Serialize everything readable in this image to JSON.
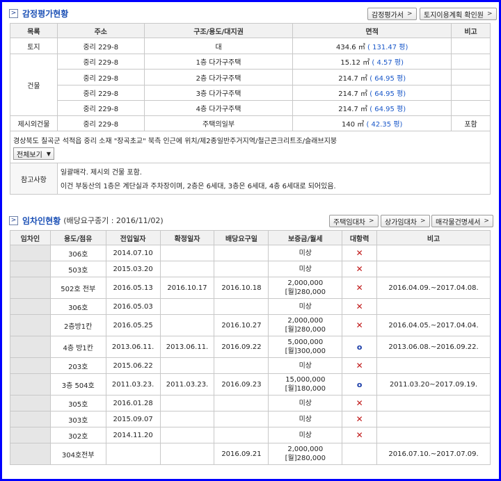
{
  "appraisal": {
    "title": "감정평가현황",
    "btn_report": "감정평가서",
    "btn_landplan": "토지이용계획 확인원",
    "headers": [
      "목록",
      "주소",
      "구조/용도/대지권",
      "면적",
      "비고"
    ],
    "rows": [
      {
        "cat": "토지",
        "addr": "중리 229-8",
        "struct": "대",
        "area": "434.6 ㎡",
        "pyeong": "( 131.47 평)",
        "note": ""
      },
      {
        "cat": "건물",
        "addr": "중리 229-8",
        "struct": "1층 다가구주택",
        "area": "15.12 ㎡",
        "pyeong": "( 4.57 평)",
        "note": ""
      },
      {
        "cat": "",
        "addr": "중리 229-8",
        "struct": "2층 다가구주택",
        "area": "214.7 ㎡",
        "pyeong": "( 64.95 평)",
        "note": ""
      },
      {
        "cat": "",
        "addr": "중리 229-8",
        "struct": "3층 다가구주택",
        "area": "214.7 ㎡",
        "pyeong": "( 64.95 평)",
        "note": ""
      },
      {
        "cat": "",
        "addr": "중리 229-8",
        "struct": "4층 다가구주택",
        "area": "214.7 ㎡",
        "pyeong": "( 64.95 평)",
        "note": ""
      },
      {
        "cat": "제시외건물",
        "addr": "중리 229-8",
        "struct": "주택의일부",
        "area": "140 ㎡",
        "pyeong": "( 42.35 평)",
        "note": "포함"
      }
    ],
    "description": "경상북도 칠곡군 석적읍 중리 소재 \"장곡초교\" 북측 인근에 위치/제2종일반주거지역/철근콘크리트조/슬래브지붕",
    "view_all": "전체보기",
    "remark_label": "참고사항",
    "remark_line1": "일괄매각. 제시외 건물 포함.",
    "remark_line2": "이건 부동산의 1층은 계단실과 주차장이며, 2층은 6세대, 3층은 6세대, 4층 6세대로 되어있음."
  },
  "tenants": {
    "title": "임차인현황",
    "subtitle": "(배당요구종기 : 2016/11/02)",
    "btn_house": "주택임대차",
    "btn_shop": "상가임대차",
    "btn_statement": "매각물건명세서",
    "headers": [
      "임차인",
      "용도/점유",
      "전입일자",
      "확정일자",
      "배당요구일",
      "보증금/월세",
      "대항력",
      "비고"
    ],
    "rows": [
      {
        "use": "306호",
        "move": "2014.07.10",
        "fixed": "",
        "claim": "",
        "dep1": "미상",
        "dep2": "",
        "power": "x",
        "note": ""
      },
      {
        "use": "503호",
        "move": "2015.03.20",
        "fixed": "",
        "claim": "",
        "dep1": "미상",
        "dep2": "",
        "power": "x",
        "note": ""
      },
      {
        "use": "502호 전부",
        "move": "2016.05.13",
        "fixed": "2016.10.17",
        "claim": "2016.10.18",
        "dep1": "2,000,000",
        "dep2": "[월]280,000",
        "power": "x",
        "note": "2016.04.09.~2017.04.08."
      },
      {
        "use": "306호",
        "move": "2016.05.03",
        "fixed": "",
        "claim": "",
        "dep1": "미상",
        "dep2": "",
        "power": "x",
        "note": ""
      },
      {
        "use": "2층방1칸",
        "move": "2016.05.25",
        "fixed": "",
        "claim": "2016.10.27",
        "dep1": "2,000,000",
        "dep2": "[월]280,000",
        "power": "x",
        "note": "2016.04.05.~2017.04.04."
      },
      {
        "use": "4층 방1칸",
        "move": "2013.06.11.",
        "fixed": "2013.06.11.",
        "claim": "2016.09.22",
        "dep1": "5,000,000",
        "dep2": "[월]300,000",
        "power": "o",
        "note": "2013.06.08.~2016.09.22."
      },
      {
        "use": "203호",
        "move": "2015.06.22",
        "fixed": "",
        "claim": "",
        "dep1": "미상",
        "dep2": "",
        "power": "x",
        "note": ""
      },
      {
        "use": "3층 504호",
        "move": "2011.03.23.",
        "fixed": "2011.03.23.",
        "claim": "2016.09.23",
        "dep1": "15,000,000",
        "dep2": "[월]180,000",
        "power": "o",
        "note": "2011.03.20~2017.09.19."
      },
      {
        "use": "305호",
        "move": "2016.01.28",
        "fixed": "",
        "claim": "",
        "dep1": "미상",
        "dep2": "",
        "power": "x",
        "note": ""
      },
      {
        "use": "303호",
        "move": "2015.09.07",
        "fixed": "",
        "claim": "",
        "dep1": "미상",
        "dep2": "",
        "power": "x",
        "note": ""
      },
      {
        "use": "302호",
        "move": "2014.11.20",
        "fixed": "",
        "claim": "",
        "dep1": "미상",
        "dep2": "",
        "power": "x",
        "note": ""
      },
      {
        "use": "304호전부",
        "move": "",
        "fixed": "",
        "claim": "2016.09.21",
        "dep1": "2,000,000",
        "dep2": "[월]280,000",
        "power": "",
        "note": "2016.07.10.~2017.07.09."
      }
    ]
  },
  "colors": {
    "frame": "#0000ff",
    "title": "#1a4fb5",
    "pyeong": "#1a58c9",
    "x_mark": "#c01818",
    "o_mark": "#1a3da8"
  }
}
